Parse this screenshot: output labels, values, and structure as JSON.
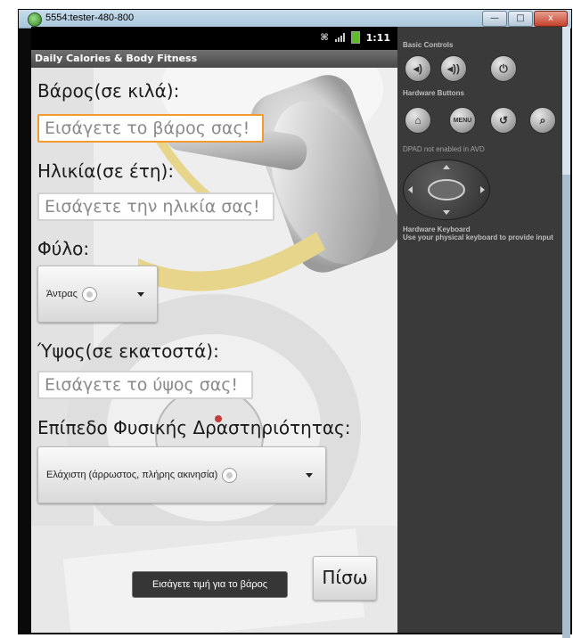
{
  "window": {
    "title": "5554:tester-480-800",
    "minimize_glyph": "—",
    "maximize_glyph": "□",
    "close_glyph": "x"
  },
  "statusbar": {
    "time": "1:11",
    "icons": [
      "debug-icon",
      "signal-icon",
      "battery-icon"
    ]
  },
  "app": {
    "title": "Daily Calories & Body Fitness"
  },
  "form": {
    "weight_label": "Βάρος(σε κιλά):",
    "weight_placeholder": "Εισάγετε το βάρος σας!",
    "age_label": "Ηλικία(σε έτη):",
    "age_placeholder": "Εισάγετε την ηλικία σας!",
    "gender_label": "Φύλο:",
    "gender_selected": "Άντρας",
    "height_label": "Ύψος(σε εκατοστά):",
    "height_placeholder": "Εισάγετε το ύψος σας!",
    "activity_label": "Επίπεδο Φυσικής Δραστηριότητας:",
    "activity_selected": "Ελάχιστη (άρρωστος, πλήρης ακινησία)"
  },
  "toast": {
    "message": "Εισάγετε τιμή για το βάρος"
  },
  "buttons": {
    "back_label": "Πίσω"
  },
  "panel": {
    "basic_controls_title": "Basic Controls",
    "hardware_buttons_title": "Hardware Buttons",
    "menu_label": "MENU",
    "dpad_note": "DPAD not enabled in AVD",
    "keyboard_title": "Hardware Keyboard",
    "keyboard_note": "Use your physical keyboard to provide input",
    "icons": [
      "volume-down-icon",
      "volume-up-icon",
      "power-icon",
      "home-icon",
      "menu-icon",
      "back-icon",
      "search-icon",
      "dpad-icon"
    ]
  },
  "colors": {
    "focus_accent": "#f39b31",
    "panel_bg": "#3a3a3a",
    "toast_bg": "#282828"
  }
}
